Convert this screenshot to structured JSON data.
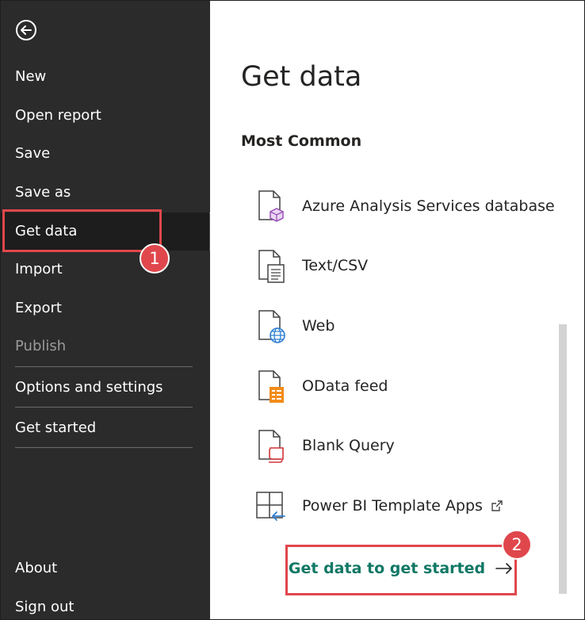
{
  "sidebar": {
    "back_icon": "back-arrow-icon",
    "items": [
      {
        "id": "new",
        "label": "New"
      },
      {
        "id": "open-report",
        "label": "Open report"
      },
      {
        "id": "save",
        "label": "Save"
      },
      {
        "id": "save-as",
        "label": "Save as"
      },
      {
        "id": "get-data",
        "label": "Get data",
        "selected": true
      },
      {
        "id": "import",
        "label": "Import"
      },
      {
        "id": "export",
        "label": "Export"
      },
      {
        "id": "publish",
        "label": "Publish",
        "disabled": true
      },
      {
        "id": "options-settings",
        "label": "Options and settings"
      },
      {
        "id": "get-started",
        "label": "Get started"
      },
      {
        "id": "about",
        "label": "About"
      },
      {
        "id": "sign-out",
        "label": "Sign out"
      }
    ]
  },
  "main": {
    "title": "Get data",
    "section": "Most Common",
    "sources": [
      {
        "label": "Azure Analysis Services database",
        "icon": "azure-cube-file-icon"
      },
      {
        "label": "Text/CSV",
        "icon": "text-file-icon"
      },
      {
        "label": "Web",
        "icon": "web-globe-file-icon"
      },
      {
        "label": "OData feed",
        "icon": "odata-file-icon"
      },
      {
        "label": "Blank Query",
        "icon": "blank-query-file-icon"
      },
      {
        "label": "Power BI Template Apps",
        "icon": "template-apps-icon",
        "external_icon": "open-external-icon"
      }
    ],
    "cta_label": "Get data to get started",
    "cta_icon": "arrow-right-icon"
  },
  "callouts": [
    {
      "number": "1"
    },
    {
      "number": "2"
    }
  ],
  "colors": {
    "sidebar_bg": "#2b2b2b",
    "sidebar_selected_bg": "#1d1d1d",
    "cta_text": "#117865",
    "callout": "#e0474c"
  }
}
